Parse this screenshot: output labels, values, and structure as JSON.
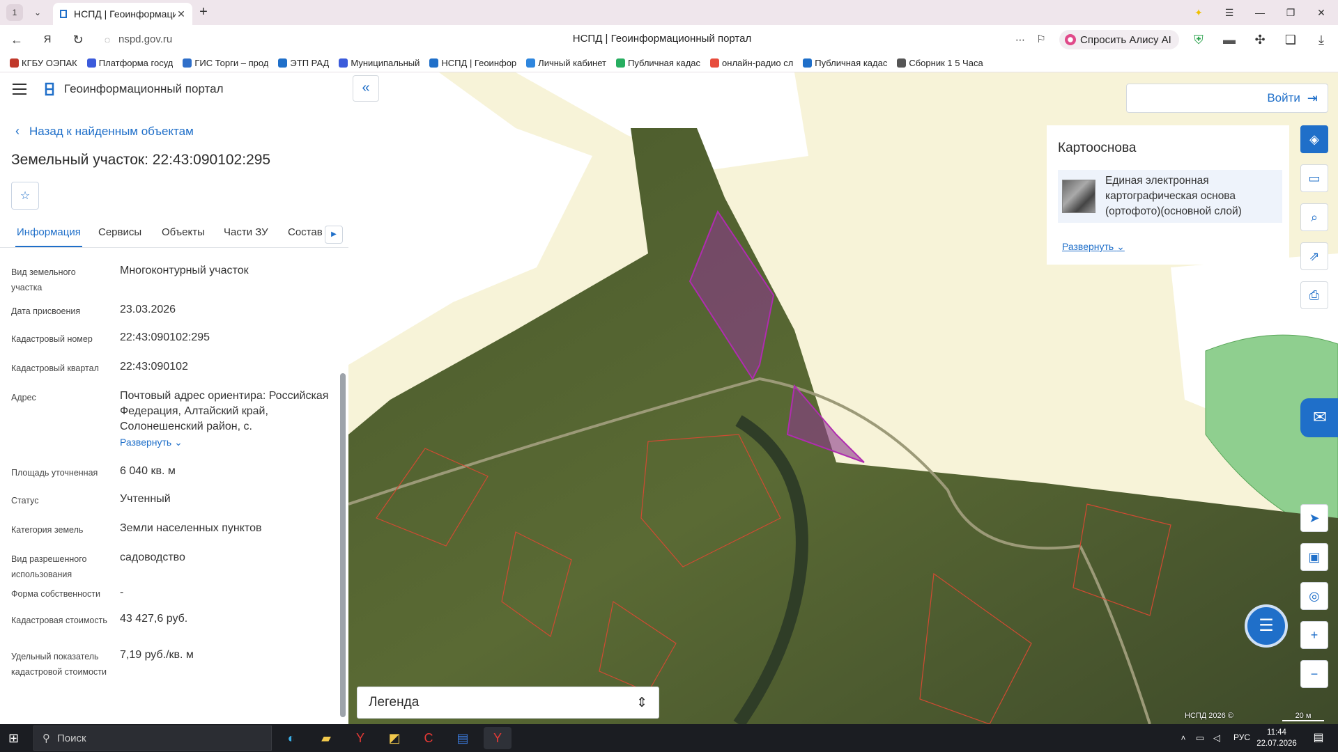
{
  "browser": {
    "tab_count": "1",
    "tab_title": "НСПД | Геоинформаци",
    "url": "nspd.gov.ru",
    "page_title": "НСПД | Геоинформационный портал",
    "alice_label": "Спросить Алису AI",
    "bookmarks": [
      {
        "label": "КГБУ ОЭПАК",
        "color": "#c0392b"
      },
      {
        "label": "Платформа госуд",
        "color": "#3b5bdb"
      },
      {
        "label": "ГИС Торги – прод",
        "color": "#2f6fc9"
      },
      {
        "label": "ЭТП РАД",
        "color": "#1f6fc9"
      },
      {
        "label": "Муниципальный",
        "color": "#3b5bdb"
      },
      {
        "label": "НСПД | Геоинфор",
        "color": "#1f6fc9"
      },
      {
        "label": "Личный кабинет",
        "color": "#2e86de"
      },
      {
        "label": "Публичная кадас",
        "color": "#27ae60"
      },
      {
        "label": "онлайн-радио сл",
        "color": "#e74c3c"
      },
      {
        "label": "Публичная кадас",
        "color": "#1f6fc9"
      },
      {
        "label": "Сборник 1 5 Часа",
        "color": "#555555"
      }
    ]
  },
  "panel": {
    "portal_name": "Геоинформационный портал",
    "back_link": "Назад к найденным объектам",
    "title": "Земельный участок: 22:43:090102:295",
    "tabs": [
      "Информация",
      "Сервисы",
      "Объекты",
      "Части ЗУ",
      "Состав"
    ],
    "properties": [
      {
        "label": "Вид земельного участка",
        "value": "Многоконтурный участок"
      },
      {
        "label": "Дата присвоения",
        "value": "23.03.2026"
      },
      {
        "label": "Кадастровый номер",
        "value": "22:43:090102:295"
      },
      {
        "label": "Кадастровый квартал",
        "value": "22:43:090102"
      },
      {
        "label": "Адрес",
        "value": "Почтовый адрес ориентира: Российская Федерация, Алтайский край, Солонешенский район, с."
      },
      {
        "label": "Площадь уточненная",
        "value": "6 040 кв. м"
      },
      {
        "label": "Статус",
        "value": "Учтенный"
      },
      {
        "label": "Категория земель",
        "value": "Земли населенных пунктов"
      },
      {
        "label": "Вид разрешенного использования",
        "value": "садоводство"
      },
      {
        "label": "Форма собственности",
        "value": "-"
      },
      {
        "label": "Кадастровая стоимость",
        "value": "43 427,6 руб."
      },
      {
        "label": "Удельный показатель кадастровой стоимости",
        "value": "7,19 руб./кв. м"
      }
    ],
    "expand_label": "Развернуть"
  },
  "map": {
    "login_label": "Войти",
    "basemap_title": "Картооснова",
    "basemap_name": "Единая электронная картографическая основа (ортофото)(основной слой)",
    "basemap_expand": "Развернуть",
    "legend_label": "Легенда",
    "copyright": "НСПД 2026 ©",
    "scale": "20 м"
  },
  "taskbar": {
    "search_placeholder": "Поиск",
    "lang": "РУС",
    "time": "11:44",
    "date": "22.07.2026"
  }
}
